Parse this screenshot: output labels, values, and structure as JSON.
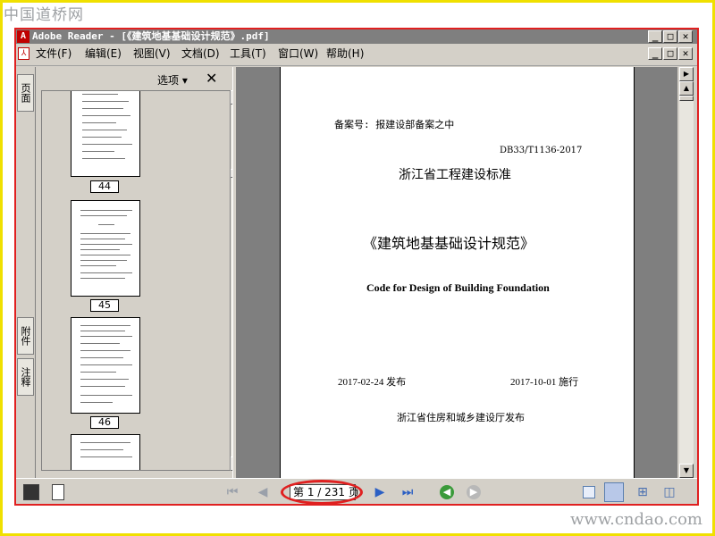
{
  "watermark": {
    "top": "中国道桥网",
    "bottom": "www.cndao.com"
  },
  "titlebar": {
    "title": "Adobe Reader - [《建筑地基基础设计规范》.pdf]",
    "app_icon": "acrobat-icon"
  },
  "window_buttons": {
    "minimize": "_",
    "maximize": "□",
    "close": "✕"
  },
  "menu": [
    {
      "label": "文件(F)"
    },
    {
      "label": "编辑(E)"
    },
    {
      "label": "视图(V)"
    },
    {
      "label": "文档(D)"
    },
    {
      "label": "工具(T)"
    },
    {
      "label": "窗口(W)"
    },
    {
      "label": "帮助(H)"
    }
  ],
  "nav_tabs": {
    "pages": "页面",
    "attachments": "附件",
    "comments": "注释"
  },
  "panel": {
    "options_label": "选项 ▾",
    "close_label": "✕"
  },
  "thumbnails": [
    {
      "page": "44"
    },
    {
      "page": "45"
    },
    {
      "page": "46"
    }
  ],
  "document": {
    "record_no": "备案号: 报建设部备案之中",
    "standard_no": "DB33/T1136-2017",
    "org_title": "浙江省工程建设标准",
    "title_cn": "《建筑地基基础设计规范》",
    "title_en": "Code for Design of Building Foundation",
    "publish_date": "2017-02-24   发布",
    "effective_date": "2017-10-01  施行",
    "publisher": "浙江省住房和城乡建设厅发布"
  },
  "statusbar": {
    "page_indicator": "第 1 / 231 页",
    "icons": [
      "first-page-icon",
      "previous-page-icon",
      "next-page-icon",
      "last-page-icon",
      "go-back-icon",
      "go-forward-icon",
      "single-page-icon",
      "continuous-icon",
      "continuous-facing-icon",
      "facing-icon"
    ]
  },
  "colors": {
    "highlight_red": "#e02020",
    "frame_yellow": "#f0e000",
    "nav_blue": "#2b5fc4",
    "nav_green": "#3a9a3a"
  }
}
